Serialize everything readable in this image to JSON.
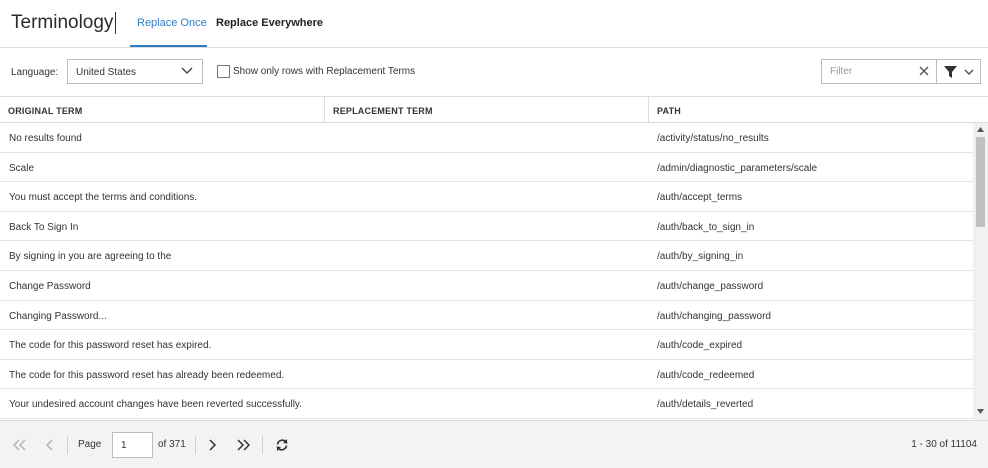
{
  "header": {
    "title": "Terminology",
    "tabs": [
      {
        "label": "Replace Once",
        "active": true
      },
      {
        "label": "Replace Everywhere",
        "active": false
      }
    ]
  },
  "toolbar": {
    "language_label": "Language:",
    "language_value": "United States",
    "show_only_label": "Show only rows with Replacement Terms",
    "show_only_checked": false,
    "filter_placeholder": "Filter"
  },
  "table": {
    "columns": [
      "ORIGINAL TERM",
      "REPLACEMENT TERM",
      "PATH"
    ],
    "rows": [
      {
        "original": "No results found",
        "replacement": "",
        "path": "/activity/status/no_results"
      },
      {
        "original": "Scale",
        "replacement": "",
        "path": "/admin/diagnostic_parameters/scale"
      },
      {
        "original": "You must accept the terms and conditions.",
        "replacement": "",
        "path": "/auth/accept_terms"
      },
      {
        "original": "Back To Sign In",
        "replacement": "",
        "path": "/auth/back_to_sign_in"
      },
      {
        "original": "By signing in you are agreeing to the",
        "replacement": "",
        "path": "/auth/by_signing_in"
      },
      {
        "original": "Change Password",
        "replacement": "",
        "path": "/auth/change_password"
      },
      {
        "original": "Changing Password...",
        "replacement": "",
        "path": "/auth/changing_password"
      },
      {
        "original": "The code for this password reset has expired.",
        "replacement": "",
        "path": "/auth/code_expired"
      },
      {
        "original": "The code for this password reset has already been redeemed.",
        "replacement": "",
        "path": "/auth/code_redeemed"
      },
      {
        "original": "Your undesired account changes have been reverted successfully.",
        "replacement": "",
        "path": "/auth/details_reverted"
      }
    ]
  },
  "pager": {
    "page_label": "Page",
    "page_value": "1",
    "of_label": "of 371",
    "range_label": "1 - 30 of 11104"
  },
  "colors": {
    "accent": "#2f7dc6",
    "border": "#dcdcdc",
    "footer_bg": "#f2f3f4"
  }
}
